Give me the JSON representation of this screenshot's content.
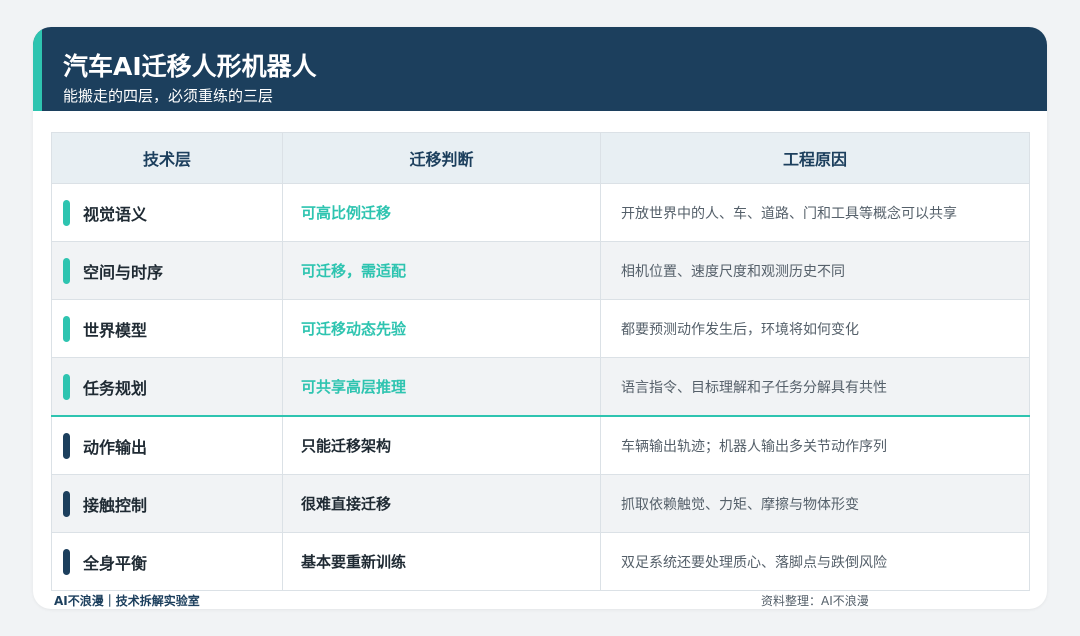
{
  "header": {
    "title": "汽车AI迁移人形机器人",
    "subtitle": "能搬走的四层，必须重练的三层"
  },
  "table": {
    "columns": [
      "技术层",
      "迁移判断",
      "工程原因"
    ],
    "rows": [
      {
        "layer": "视觉语义",
        "judgment": "可高比例迁移",
        "reason": "开放世界中的人、车、道路、门和工具等概念可以共享",
        "group": "transferable"
      },
      {
        "layer": "空间与时序",
        "judgment": "可迁移，需适配",
        "reason": "相机位置、速度尺度和观测历史不同",
        "group": "transferable"
      },
      {
        "layer": "世界模型",
        "judgment": "可迁移动态先验",
        "reason": "都要预测动作发生后，环境将如何变化",
        "group": "transferable"
      },
      {
        "layer": "任务规划",
        "judgment": "可共享高层推理",
        "reason": "语言指令、目标理解和子任务分解具有共性",
        "group": "transferable"
      },
      {
        "layer": "动作输出",
        "judgment": "只能迁移架构",
        "reason": "车辆输出轨迹；机器人输出多关节动作序列",
        "group": "retrain"
      },
      {
        "layer": "接触控制",
        "judgment": "很难直接迁移",
        "reason": "抓取依赖触觉、力矩、摩擦与物体形变",
        "group": "retrain"
      },
      {
        "layer": "全身平衡",
        "judgment": "基本要重新训练",
        "reason": "双足系统还要处理质心、落脚点与跌倒风险",
        "group": "retrain"
      }
    ]
  },
  "footer": {
    "left": "AI不浪漫｜技术拆解实验室",
    "right": "资料整理：AI不浪漫"
  },
  "colors": {
    "navy": "#1c3f5d",
    "teal": "#2ec4b0"
  }
}
